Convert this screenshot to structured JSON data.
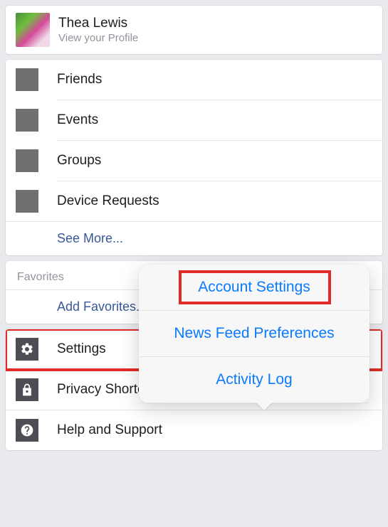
{
  "profile": {
    "name": "Thea Lewis",
    "subtitle": "View your Profile"
  },
  "shortcuts": {
    "items": [
      {
        "label": "Friends"
      },
      {
        "label": "Events"
      },
      {
        "label": "Groups"
      },
      {
        "label": "Device Requests"
      }
    ],
    "see_more": "See More..."
  },
  "favorites": {
    "header": "Favorites",
    "add_label": "Add Favorites..."
  },
  "settings_group": {
    "settings": "Settings",
    "privacy": "Privacy Shortcuts",
    "help": "Help and Support"
  },
  "popover": {
    "account_settings": "Account Settings",
    "news_feed_prefs": "News Feed Preferences",
    "activity_log": "Activity Log"
  }
}
